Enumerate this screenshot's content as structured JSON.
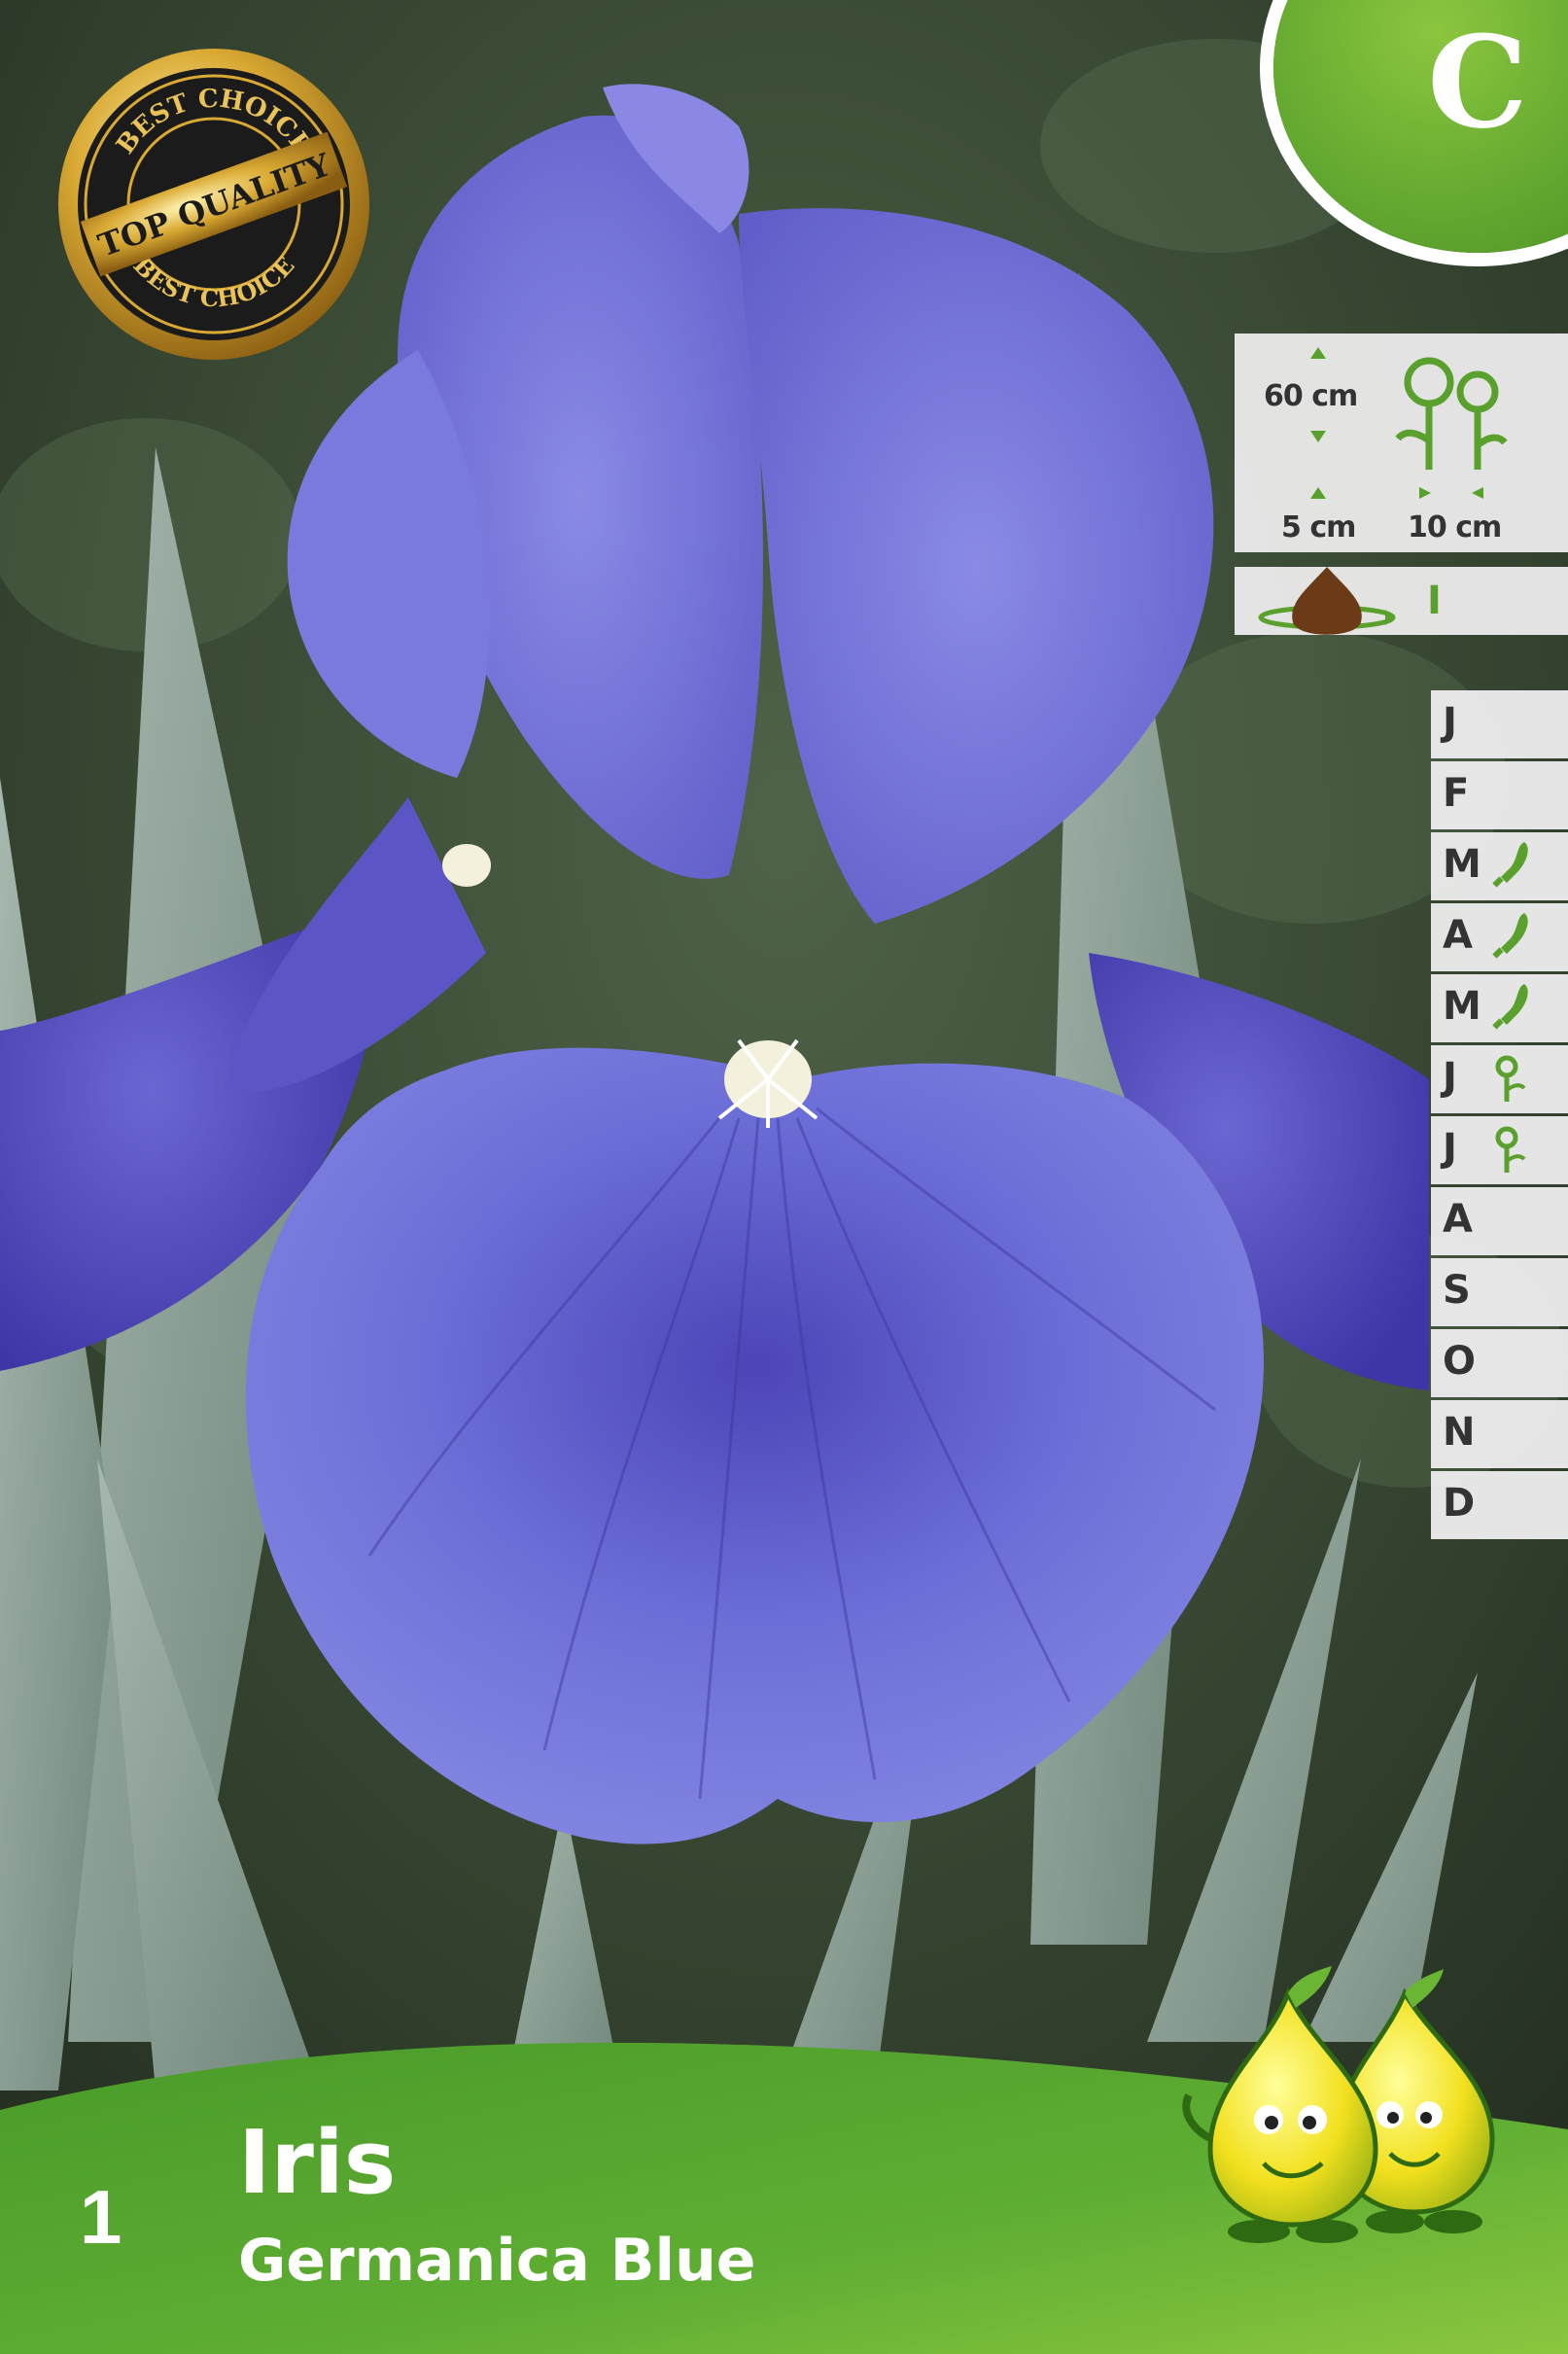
{
  "category": "C",
  "seal": {
    "top_text": "BEST CHOICE",
    "center_text": "TOP QUALITY",
    "bottom_text": "BEST CHOICE"
  },
  "specs": {
    "height": "60 cm",
    "depth": "5 cm",
    "spacing": "10 cm",
    "planting_marker": "I"
  },
  "months": [
    {
      "letter": "J",
      "icon": ""
    },
    {
      "letter": "F",
      "icon": ""
    },
    {
      "letter": "M",
      "icon": "trowel-icon"
    },
    {
      "letter": "A",
      "icon": "trowel-icon"
    },
    {
      "letter": "M",
      "icon": "trowel-icon"
    },
    {
      "letter": "J",
      "icon": "flower-icon"
    },
    {
      "letter": "J",
      "icon": "flower-icon"
    },
    {
      "letter": "A",
      "icon": ""
    },
    {
      "letter": "S",
      "icon": ""
    },
    {
      "letter": "O",
      "icon": ""
    },
    {
      "letter": "N",
      "icon": ""
    },
    {
      "letter": "D",
      "icon": ""
    }
  ],
  "product": {
    "quantity": "1",
    "name": "Iris",
    "variety": "Germanica Blue"
  },
  "colors": {
    "accent_green": "#6ab534",
    "petal": "#6b6fd6",
    "leaf": "#8fa39a"
  }
}
